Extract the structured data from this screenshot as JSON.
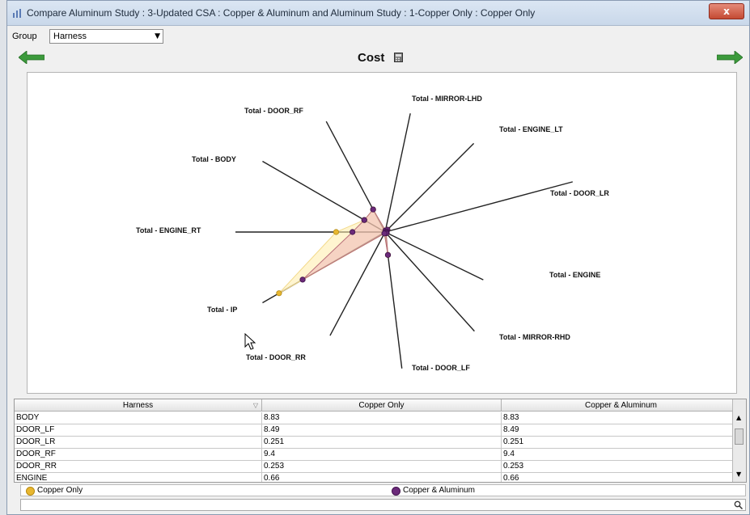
{
  "window": {
    "title": "Compare Aluminum Study : 3-Updated CSA : Copper & Aluminum and Aluminum Study : 1-Copper Only : Copper Only",
    "close_label": "x"
  },
  "group": {
    "label": "Group",
    "value": "Harness"
  },
  "chart_title": "Cost",
  "chart_data": {
    "type": "radar",
    "axes": [
      "Total - MIRROR-LHD",
      "Total - ENGINE_LT",
      "Total - DOOR_LR",
      "Total - ENGINE",
      "Total - MIRROR-RHD",
      "Total - DOOR_LF",
      "Total - DOOR_RR",
      "Total - IP",
      "Total - ENGINE_RT",
      "Total - BODY",
      "Total - DOOR_RF"
    ],
    "series": [
      {
        "name": "Copper Only",
        "color": "#e8b730",
        "values": [
          0.3,
          1.2,
          0.251,
          0.66,
          0.2,
          8.49,
          0.253,
          45,
          18,
          8.83,
          9.4
        ]
      },
      {
        "name": "Copper & Aluminum",
        "color": "#6b2a7a",
        "values": [
          0.3,
          1.2,
          0.251,
          0.66,
          0.2,
          8.49,
          0.253,
          35,
          12,
          8.83,
          9.4
        ]
      }
    ]
  },
  "table": {
    "headers": [
      "Harness",
      "Copper Only",
      "Copper & Aluminum"
    ],
    "rows": [
      [
        "BODY",
        "8.83",
        "8.83"
      ],
      [
        "DOOR_LF",
        "8.49",
        "8.49"
      ],
      [
        "DOOR_LR",
        "0.251",
        "0.251"
      ],
      [
        "DOOR_RF",
        "9.4",
        "9.4"
      ],
      [
        "DOOR_RR",
        "0.253",
        "0.253"
      ],
      [
        "ENGINE",
        "0.66",
        "0.66"
      ]
    ]
  },
  "legend": [
    {
      "label": "Copper Only",
      "color": "#e8b730"
    },
    {
      "label": "Copper & Aluminum",
      "color": "#6b2a7a"
    }
  ],
  "search": {
    "placeholder": ""
  }
}
